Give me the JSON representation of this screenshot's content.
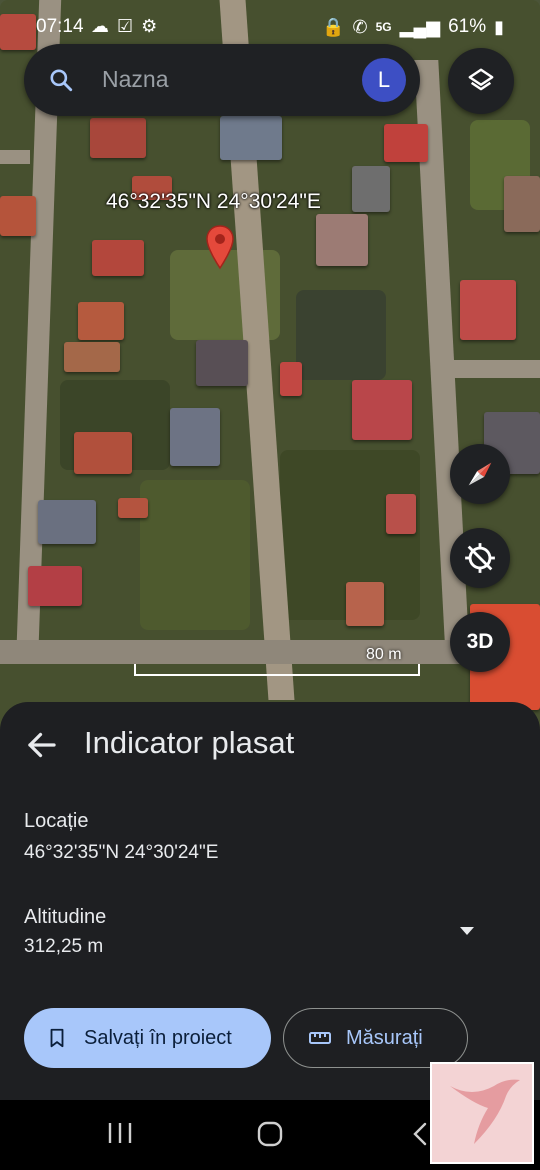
{
  "status_bar": {
    "time": "07:14",
    "left_icons": [
      "cloud-icon",
      "check-box-icon",
      "gear-icon"
    ],
    "right_icons": [
      "vpn-key-icon",
      "call-icon",
      "5g-icon",
      "signal-icon"
    ],
    "network": "5G",
    "battery_percent": "61%"
  },
  "search": {
    "placeholder": "Nazna",
    "avatar_letter": "L",
    "avatar_color": "#3d4fc4"
  },
  "map": {
    "marker_coordinates": "46°32'35\"N 24°30'24\"E",
    "scale_label": "80 m",
    "three_d_label": "3D",
    "pin_color": "#e5493b"
  },
  "sheet": {
    "title": "Indicator plasat",
    "location_label": "Locație",
    "location_value": "46°32'35\"N 24°30'24\"E",
    "altitude_label": "Altitudine",
    "altitude_value": "312,25 m",
    "save_button": "Salvați în proiect",
    "measure_button": "Măsurați",
    "accent": "#a8c7fa"
  }
}
